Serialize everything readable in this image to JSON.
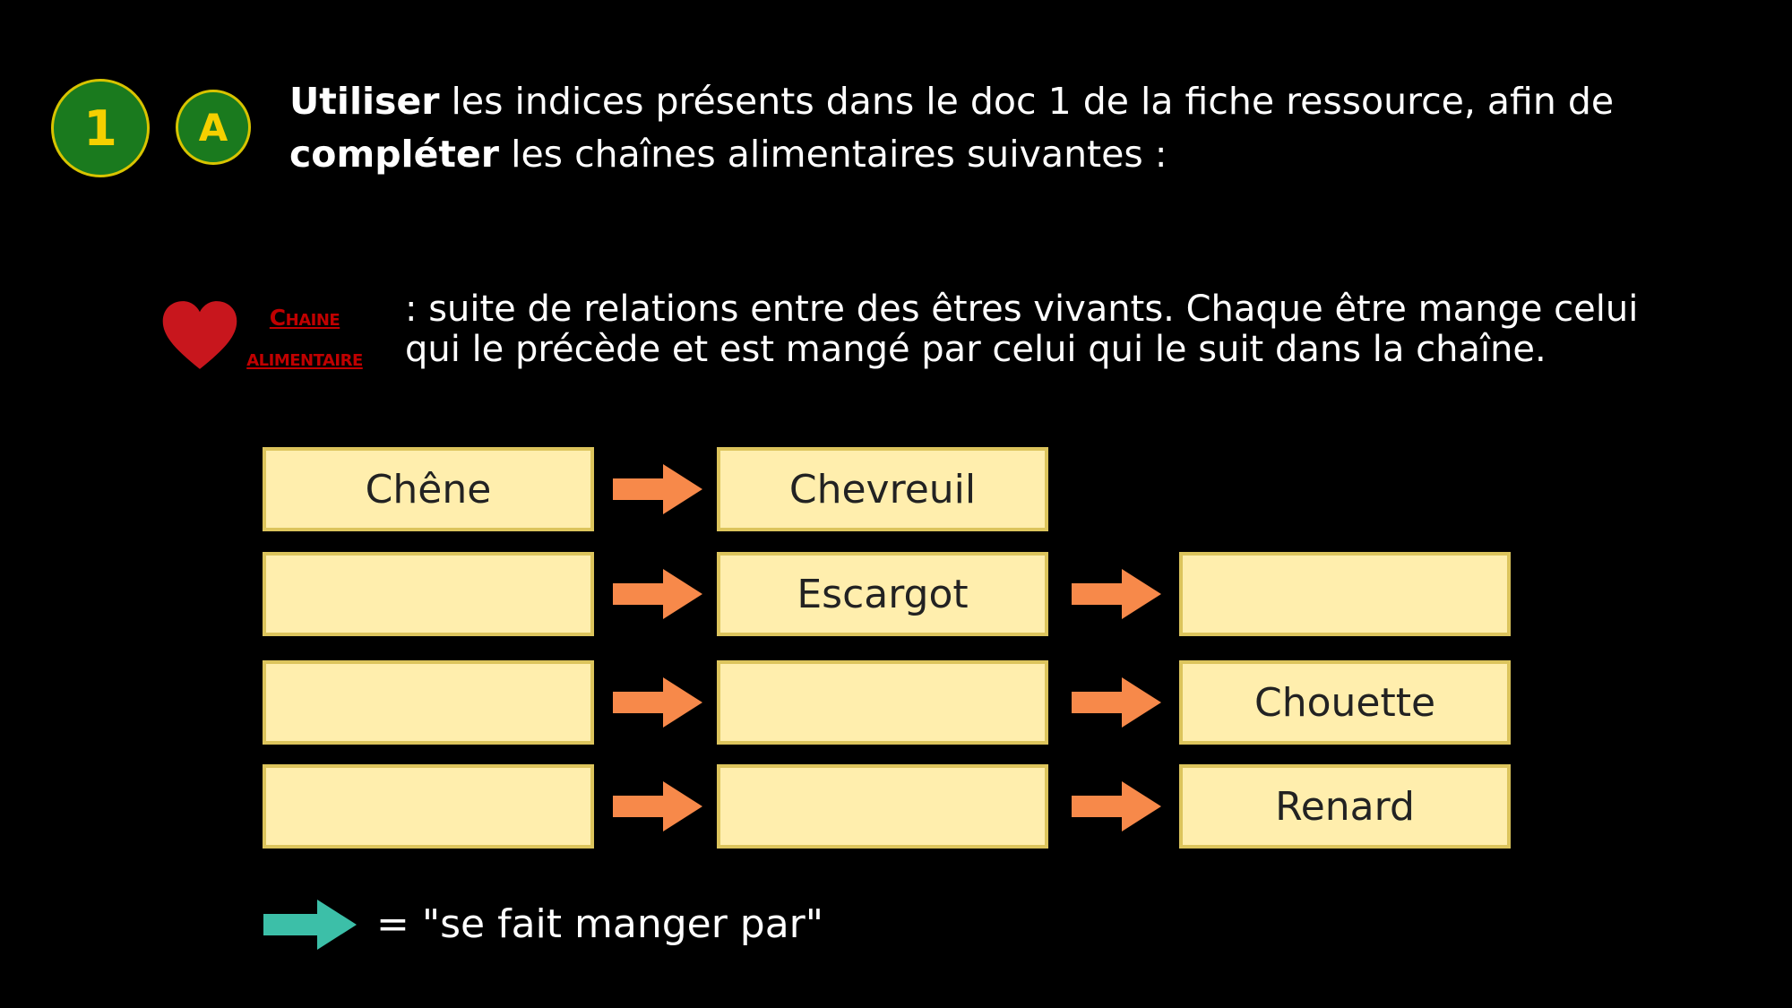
{
  "badges": {
    "step": "1",
    "part": "A"
  },
  "instruction": {
    "bold1": "Utiliser",
    "text1": " les indices présents dans le doc 1 de la fiche ressource, afin de ",
    "bold2": "compléter",
    "text2": " les chaînes alimentaires suivantes :"
  },
  "definition": {
    "term_line1": "Chaine",
    "term_line2": "alimentaire",
    "line1": ": suite de relations entre des êtres vivants. Chaque être mange celui",
    "line2": "qui le précède et est mangé par celui qui le suit dans la chaîne."
  },
  "chains": [
    [
      "Chêne",
      "Chevreuil"
    ],
    [
      "",
      "Escargot",
      ""
    ],
    [
      "",
      "",
      "Chouette"
    ],
    [
      "",
      "",
      "Renard"
    ]
  ],
  "legend": {
    "text": "= \"se fait manger par\""
  },
  "colors": {
    "box_fill": "#ffeead",
    "arrow_orange": "#f7894a",
    "arrow_teal": "#3cbfa8",
    "term_red": "#c00000"
  }
}
